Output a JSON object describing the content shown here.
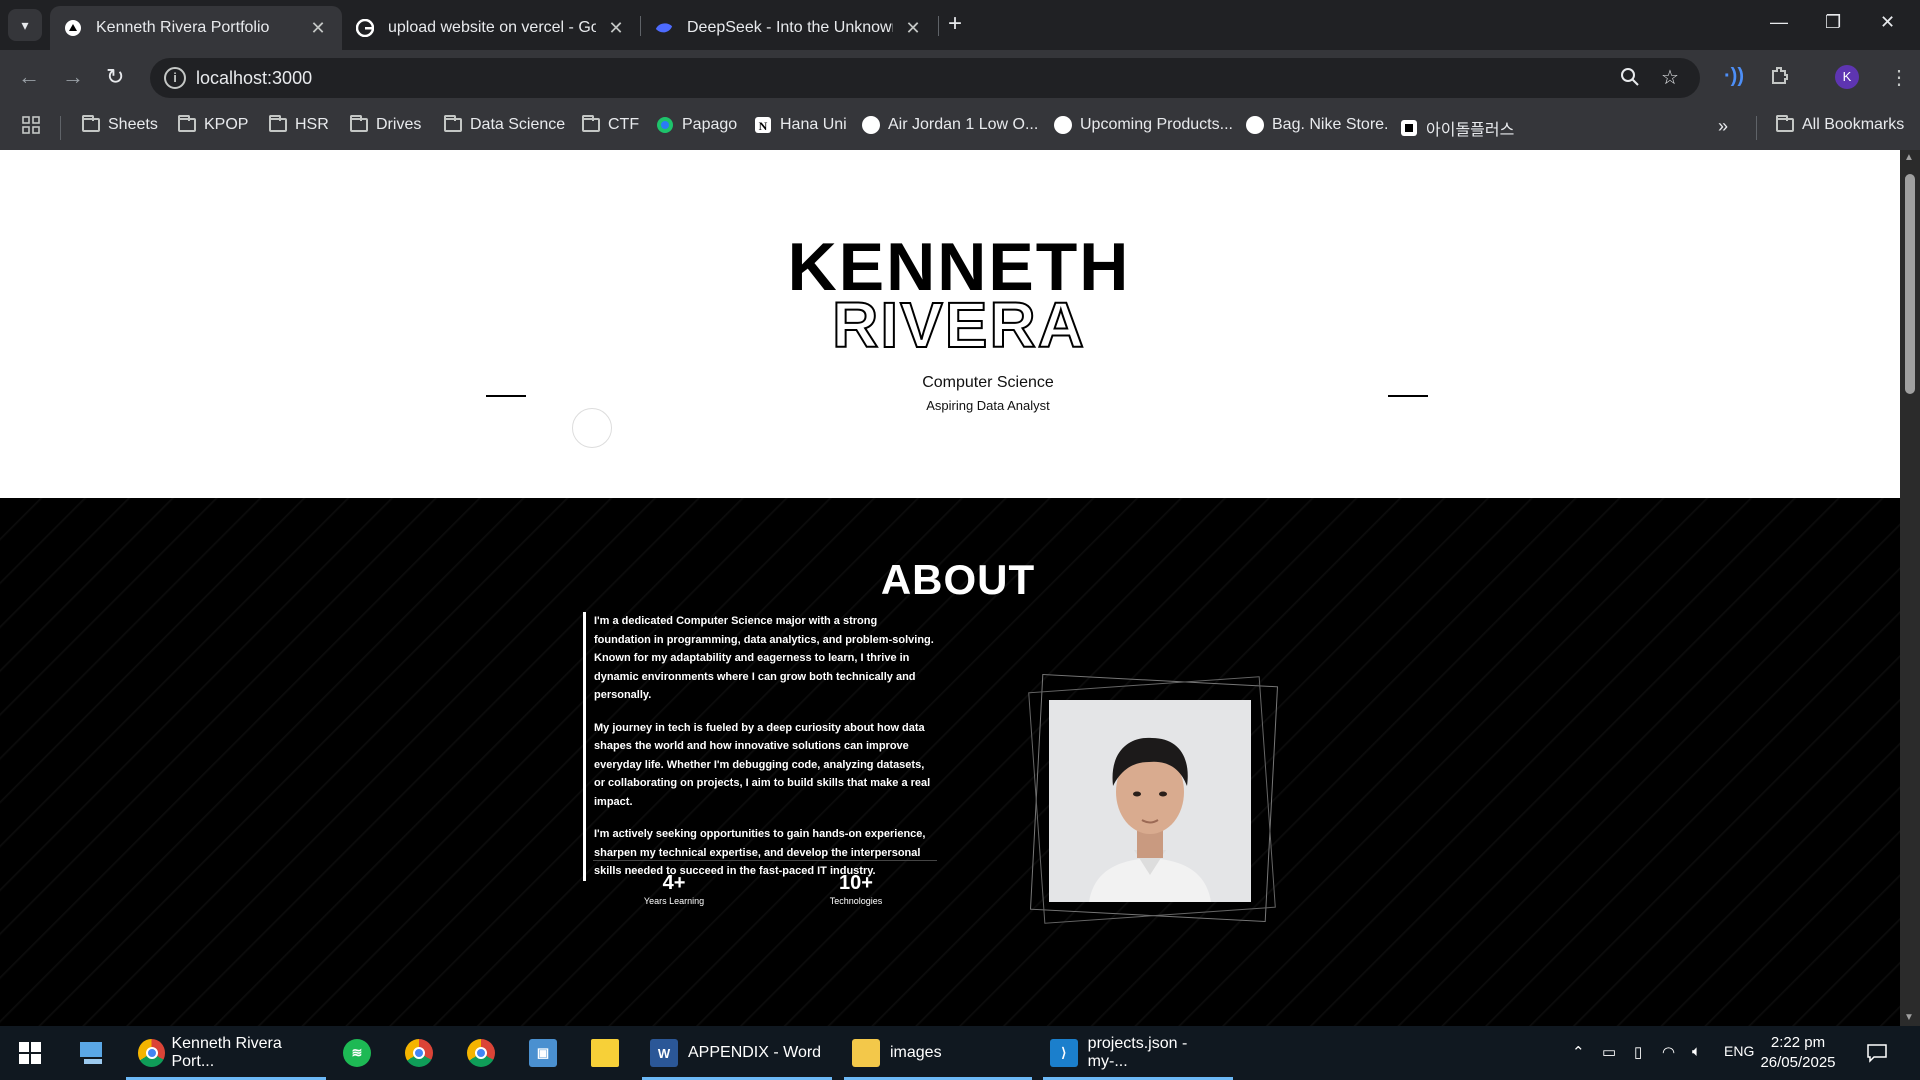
{
  "browser": {
    "tabs": [
      {
        "title": "Kenneth Rivera Portfolio",
        "active": true
      },
      {
        "title": "upload website on vercel - Goo",
        "active": false
      },
      {
        "title": "DeepSeek - Into the Unknown",
        "active": false
      }
    ],
    "url": "localhost:3000",
    "profile_initial": "K",
    "bookmarks": [
      "Sheets",
      "KPOP",
      "HSR",
      "Drives",
      "Data Science",
      "CTF",
      "Papago",
      "Hana Uni",
      "Air Jordan 1 Low O...",
      "Upcoming Products...",
      "Bag. Nike Store.",
      "아이돌플러스"
    ],
    "all_bookmarks": "All Bookmarks"
  },
  "hero": {
    "first_name": "KENNETH",
    "last_name": "RIVERA",
    "role": "Computer Science",
    "subtitle": "Aspiring Data Analyst"
  },
  "about": {
    "title": "ABOUT",
    "paragraphs": [
      "I'm a dedicated Computer Science major with a strong foundation in programming, data analytics, and problem-solving. Known for my adaptability and eagerness to learn, I thrive in dynamic environments where I can grow both technically and personally.",
      "My journey in tech is fueled by a deep curiosity about how data shapes the world and how innovative solutions can improve everyday life. Whether I'm debugging code, analyzing datasets, or collaborating on projects, I aim to build skills that make a real impact.",
      "I'm actively seeking opportunities to gain hands-on experience, sharpen my technical expertise, and develop the interpersonal skills needed to succeed in the fast-paced IT industry."
    ],
    "stats": [
      {
        "value": "4+",
        "label": "Years Learning"
      },
      {
        "value": "10+",
        "label": "Technologies"
      }
    ]
  },
  "taskbar": {
    "items": [
      {
        "label": "Kenneth Rivera Port...",
        "icon": "chrome-icon"
      },
      {
        "label": "APPENDIX - Word",
        "icon": "word-icon"
      },
      {
        "label": "images",
        "icon": "folder-icon"
      },
      {
        "label": "projects.json - my-...",
        "icon": "vscode-icon"
      }
    ],
    "language": "ENG",
    "time": "2:22 pm",
    "date": "26/05/2025"
  }
}
